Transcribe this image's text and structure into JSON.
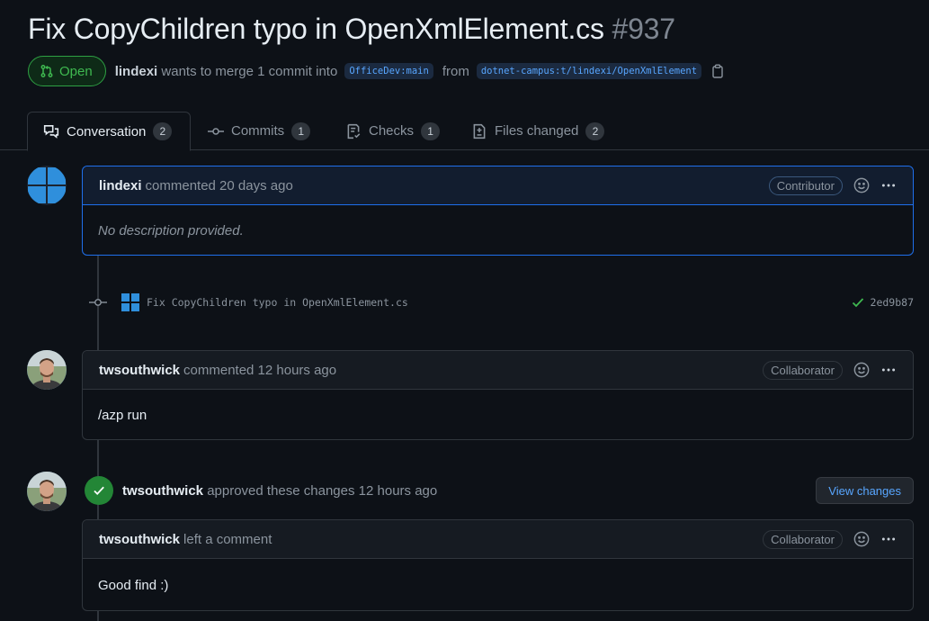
{
  "pr": {
    "title": "Fix CopyChildren typo in OpenXmlElement.cs",
    "number": "#937",
    "state": "Open",
    "author": "lindexi",
    "merge_text": "wants to merge 1 commit into",
    "base_branch": "OfficeDev:main",
    "from_text": "from",
    "head_branch": "dotnet-campus:t/lindexi/OpenXmlElement"
  },
  "tabs": [
    {
      "label": "Conversation",
      "count": "2"
    },
    {
      "label": "Commits",
      "count": "1"
    },
    {
      "label": "Checks",
      "count": "1"
    },
    {
      "label": "Files changed",
      "count": "2"
    }
  ],
  "timeline": {
    "comment1": {
      "author": "lindexi",
      "action": "commented 20 days ago",
      "role": "Contributor",
      "body": "No description provided."
    },
    "commit": {
      "message": "Fix CopyChildren typo in OpenXmlElement.cs",
      "sha": "2ed9b87"
    },
    "comment2": {
      "author": "twsouthwick",
      "action": "commented 12 hours ago",
      "role": "Collaborator",
      "body": "/azp run"
    },
    "review": {
      "author": "twsouthwick",
      "action": "approved these changes",
      "time": "12 hours ago",
      "button": "View changes"
    },
    "review_comment": {
      "author": "twsouthwick",
      "action": "left a comment",
      "role": "Collaborator",
      "body": "Good find :)"
    }
  },
  "colors": {
    "background": "#0d1117",
    "accent_blue": "#58a6ff",
    "open_green": "#3fb950",
    "approve_green": "#238636"
  }
}
